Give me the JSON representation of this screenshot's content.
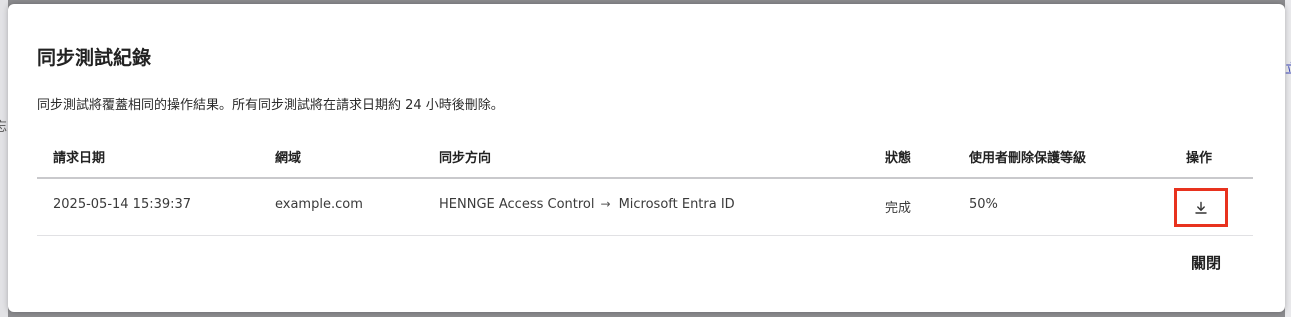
{
  "background": {
    "right_edge_fragment": "立",
    "left_edge_fragment": "忘"
  },
  "dialog": {
    "title": "同步測試紀錄",
    "description": "同步測試將覆蓋相同的操作結果。所有同步測試將在請求日期約 24 小時後刪除。",
    "table": {
      "headers": {
        "request_date": "請求日期",
        "domain": "網域",
        "sync_direction": "同步方向",
        "status": "狀態",
        "protection_level": "使用者刪除保護等級",
        "actions": "操作"
      },
      "rows": [
        {
          "request_date": "2025-05-14 15:39:37",
          "domain": "example.com",
          "direction_from": "HENNGE Access Control",
          "direction_to": "Microsoft Entra ID",
          "status": "完成",
          "protection_level": "50%",
          "action_icon": "download-icon"
        }
      ]
    },
    "close_label": "關閉"
  },
  "colors": {
    "highlight_border": "#e8321e",
    "overlay": "#8c8c8f"
  }
}
